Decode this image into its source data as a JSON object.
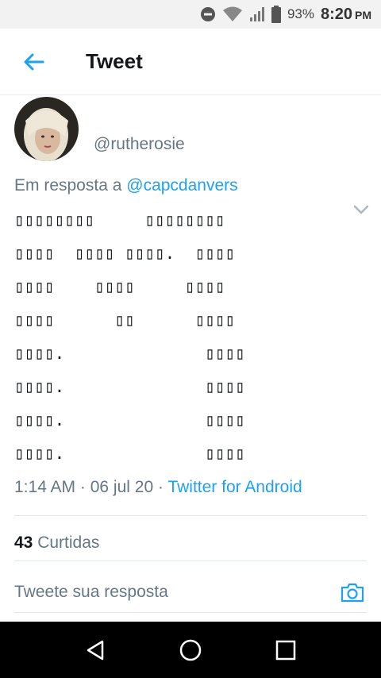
{
  "status_bar": {
    "battery": "93%",
    "time": "8:20",
    "ampm": "PM",
    "icons": [
      "do-not-disturb-icon",
      "wifi-icon",
      "signal-icon",
      "battery-icon"
    ]
  },
  "header": {
    "title": "Tweet",
    "back_icon": "arrow-left-icon"
  },
  "tweet": {
    "handle": "@rutherosie",
    "reply_prefix": "Em resposta a",
    "reply_to": "@capcdanvers",
    "body_lines": [
      "▯▯▯▯▯▯▯▯     ▯▯▯▯▯▯▯▯",
      "▯▯▯▯  ▯▯▯▯ ▯▯▯▯.  ▯▯▯▯",
      "▯▯▯▯    ▯▯▯▯     ▯▯▯▯",
      "▯▯▯▯      ▯▯      ▯▯▯▯",
      "▯▯▯▯.              ▯▯▯▯",
      "▯▯▯▯.              ▯▯▯▯",
      "▯▯▯▯.              ▯▯▯▯",
      "▯▯▯▯.              ▯▯▯▯"
    ],
    "time": "1:14 AM",
    "date": "06 jul 20",
    "source": "Twitter for Android",
    "likes_count": "43",
    "likes_label": "Curtidas"
  },
  "compose": {
    "placeholder": "Tweete sua resposta"
  },
  "colors": {
    "accent": "#1da1f2",
    "muted": "#657786",
    "text": "#14171a"
  }
}
